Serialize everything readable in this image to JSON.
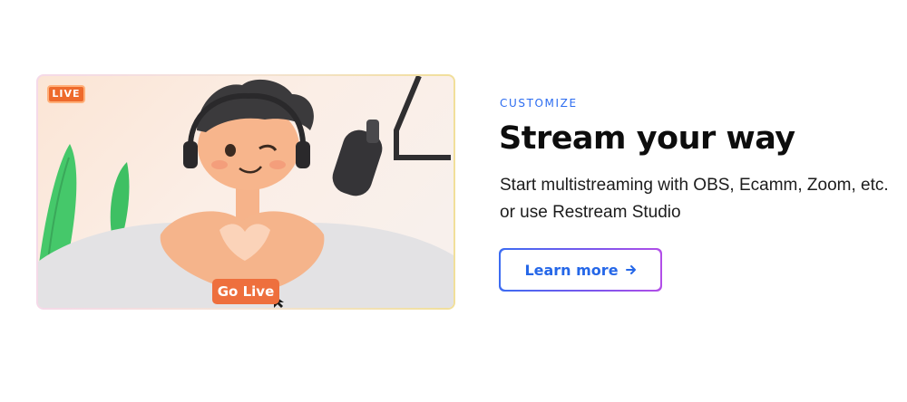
{
  "illustration": {
    "live_badge": "LIVE",
    "shirt_label": "Go Live"
  },
  "content": {
    "eyebrow": "CUSTOMIZE",
    "headline": "Stream your way",
    "description": "Start multistreaming with OBS, Ecamm, Zoom, etc. or use Restream Studio",
    "cta_label": "Learn more",
    "cta_icon": "arrow-right-icon"
  },
  "colors": {
    "accent": "#2567e8",
    "eyebrow": "#2c6cf0",
    "badge": "#ee6a2c",
    "headline": "#0d0d0d"
  }
}
